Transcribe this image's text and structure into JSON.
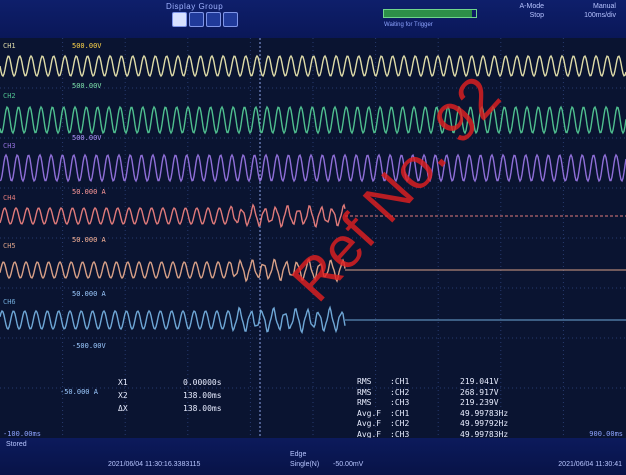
{
  "topbar": {
    "title": "Display Group",
    "groups": [
      "",
      "",
      "",
      ""
    ],
    "progress_label": "Waiting for Trigger",
    "progress": 0.96,
    "mode_line1": "A-Mode",
    "mode_line2": "Stop",
    "mode2_line1": "Manual",
    "mode2_line2": "100ms/div"
  },
  "channels": [
    {
      "label": "CH1",
      "scale": "500.00V",
      "color": "#dedba8"
    },
    {
      "label": "CH2",
      "scale": "500.00V",
      "color": "#4fbf8f"
    },
    {
      "label": "CH3",
      "scale": "500.00V",
      "color": "#8f6fd8"
    },
    {
      "label": "CH4",
      "scale": "50.000 A",
      "color": "#e07a7a"
    },
    {
      "label": "CH5",
      "scale": "50.000 A",
      "color": "#d8a087"
    },
    {
      "label": "CH6",
      "scale": "50.000 A",
      "color": "#6fa7d6"
    }
  ],
  "extra_scales": [
    "-500.00V",
    "-50.000 A"
  ],
  "cursor": {
    "x1_label": "X1",
    "x1_value": "0.00000s",
    "x2_label": "X2",
    "x2_value": "138.00ms",
    "dx_label": "ΔX",
    "dx_value": "138.00ms"
  },
  "measurements": [
    {
      "name": "RMS",
      "ch": ":CH1",
      "value": "219.041V"
    },
    {
      "name": "RMS",
      "ch": ":CH2",
      "value": "268.917V"
    },
    {
      "name": "RMS",
      "ch": ":CH3",
      "value": "219.239V"
    },
    {
      "name": "Avg.F",
      "ch": ":CH1",
      "value": "49.99783Hz"
    },
    {
      "name": "Avg.F",
      "ch": ":CH2",
      "value": "49.99792Hz"
    },
    {
      "name": "Avg.F",
      "ch": ":CH3",
      "value": "49.99783Hz"
    }
  ],
  "left_axis_label": "-100.00ms",
  "right_axis_label": "900.00ms",
  "status": {
    "left": "Stored",
    "trigger_time": "2021/06/04 11:30:16.3383115",
    "edge_label": "Edge",
    "trigger_source": "Single(N)",
    "trigger_level": "-50.00mV",
    "right_time": "2021/06/04 11:30:41"
  },
  "watermark": {
    "text": "Ref No. 92",
    "color": "#e02020"
  }
}
